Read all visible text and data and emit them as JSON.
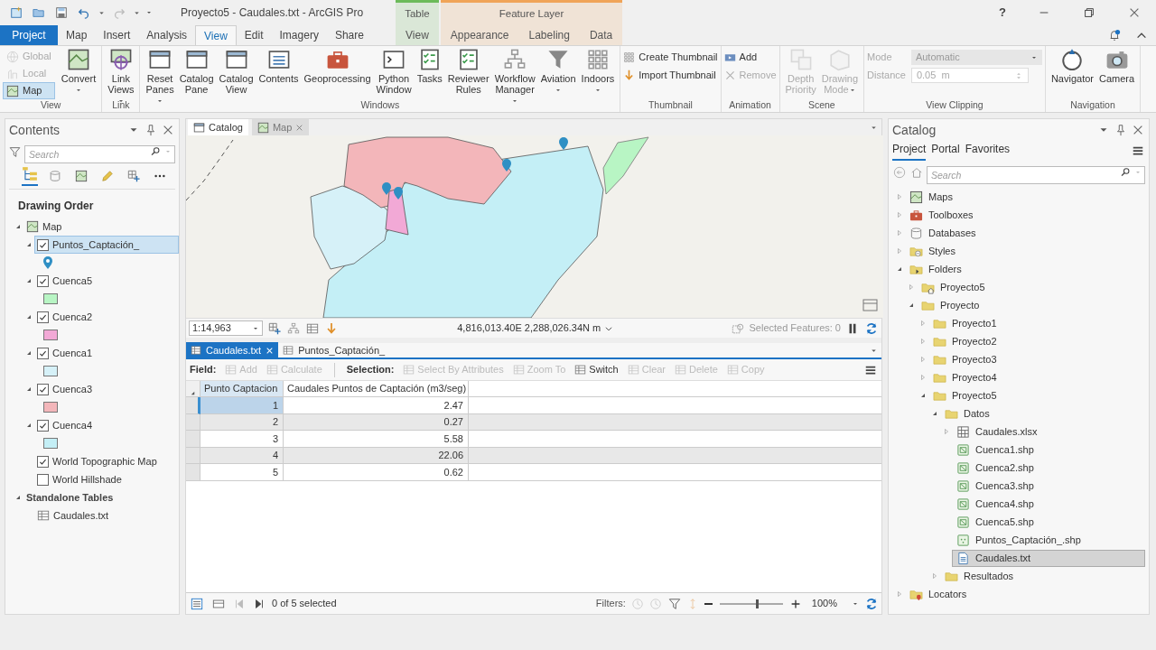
{
  "window": {
    "title": "Proyecto5 - Caudales.txt - ArcGIS Pro",
    "help": "?"
  },
  "ribbon": {
    "tabs": [
      {
        "label": "Project",
        "kind": "project",
        "selected": false
      },
      {
        "label": "Map",
        "kind": "core",
        "selected": false
      },
      {
        "label": "Insert",
        "kind": "core",
        "selected": false
      },
      {
        "label": "Analysis",
        "kind": "core",
        "selected": false
      },
      {
        "label": "View",
        "kind": "core",
        "selected": true
      },
      {
        "label": "Edit",
        "kind": "core",
        "selected": false
      },
      {
        "label": "Imagery",
        "kind": "core",
        "selected": false
      },
      {
        "label": "Share",
        "kind": "core",
        "selected": false
      }
    ],
    "context_groups": [
      {
        "label": "Table",
        "color": "#6cbb5a",
        "tabs": [
          {
            "label": "View",
            "selected": false
          }
        ]
      },
      {
        "label": "Feature Layer",
        "color": "#f0a458",
        "tabs": [
          {
            "label": "Appearance",
            "selected": false
          },
          {
            "label": "Labeling",
            "selected": false
          },
          {
            "label": "Data",
            "selected": false
          }
        ]
      }
    ],
    "groups": [
      {
        "label": "View",
        "modes": [
          {
            "label": "Global",
            "disabled": true,
            "selected": false
          },
          {
            "label": "Local",
            "disabled": true,
            "selected": false
          },
          {
            "label": "Map",
            "disabled": false,
            "selected": true
          }
        ],
        "tools": [
          {
            "label": "Convert",
            "kind": "large",
            "disabled": false,
            "dropdown": true
          }
        ]
      },
      {
        "label": "Link",
        "tools": [
          {
            "label": "Link Views",
            "kind": "large",
            "disabled": false,
            "dropdown": true
          }
        ]
      },
      {
        "label": "Windows",
        "tools": [
          {
            "label": "Reset Panes",
            "kind": "large",
            "disabled": false,
            "dropdown": true
          },
          {
            "label": "Catalog Pane",
            "kind": "large",
            "disabled": false,
            "dropdown": false
          },
          {
            "label": "Catalog View",
            "kind": "large",
            "disabled": false,
            "dropdown": false
          },
          {
            "label": "Contents",
            "kind": "large",
            "disabled": false,
            "dropdown": false
          },
          {
            "label": "Geoprocessing",
            "kind": "large",
            "disabled": false,
            "dropdown": false
          },
          {
            "label": "Python Window",
            "kind": "large",
            "disabled": false,
            "dropdown": false
          },
          {
            "label": "Tasks",
            "kind": "large",
            "disabled": false,
            "dropdown": false
          },
          {
            "label": "Reviewer Rules",
            "kind": "large",
            "disabled": false,
            "dropdown": false
          },
          {
            "label": "Workflow Manager",
            "kind": "large",
            "disabled": false,
            "dropdown": true
          },
          {
            "label": "Aviation",
            "kind": "large",
            "disabled": false,
            "dropdown": true
          },
          {
            "label": "Indoors",
            "kind": "large",
            "disabled": false,
            "dropdown": true
          }
        ]
      },
      {
        "label": "Thumbnail",
        "tools": [
          {
            "label": "Create Thumbnail",
            "kind": "small",
            "disabled": false,
            "dropdown": false
          },
          {
            "label": "Import Thumbnail",
            "kind": "small",
            "disabled": false,
            "dropdown": false
          }
        ]
      },
      {
        "label": "Animation",
        "tools": [
          {
            "label": "Add",
            "kind": "small",
            "disabled": false,
            "dropdown": false
          },
          {
            "label": "Remove",
            "kind": "small",
            "disabled": true,
            "dropdown": false
          }
        ]
      },
      {
        "label": "Scene",
        "tools": [
          {
            "label": "Depth Priority",
            "kind": "large",
            "disabled": true,
            "dropdown": false
          },
          {
            "label": "Drawing Mode",
            "kind": "large",
            "disabled": true,
            "dropdown": true
          }
        ]
      },
      {
        "label": "View Clipping",
        "tools": [
          {
            "label": "Mode",
            "kind": "dropdown",
            "value": "Automatic",
            "disabled": true,
            "dropdown": true
          },
          {
            "label": "Distance",
            "kind": "spinner",
            "value": "0.05  m",
            "disabled": true
          }
        ]
      },
      {
        "label": "Navigation",
        "tools": [
          {
            "label": "Navigator",
            "kind": "large",
            "disabled": false,
            "dropdown": false
          },
          {
            "label": "Camera",
            "kind": "large",
            "disabled": false,
            "dropdown": false
          }
        ]
      }
    ]
  },
  "contents": {
    "title": "Contents",
    "search": {
      "placeholder": "Search"
    },
    "heading": "Drawing Order",
    "tree": [
      {
        "label": "Map",
        "kind": "map",
        "expanded": true,
        "selected": false,
        "children": [
          {
            "label": "Puntos_Captación_",
            "kind": "point_layer",
            "color": "#2f8fc4",
            "checked": true,
            "expanded": true,
            "selected": true
          },
          {
            "label": "Cuenca5",
            "kind": "polygon_layer",
            "color": "#b8f5c4",
            "checked": true,
            "expanded": true,
            "selected": false
          },
          {
            "label": "Cuenca2",
            "kind": "polygon_layer",
            "color": "#f2a9d6",
            "checked": true,
            "expanded": true,
            "selected": false
          },
          {
            "label": "Cuenca1",
            "kind": "polygon_layer",
            "color": "#d6f1f8",
            "checked": true,
            "expanded": true,
            "selected": false
          },
          {
            "label": "Cuenca3",
            "kind": "polygon_layer",
            "color": "#f3b6ba",
            "checked": true,
            "expanded": true,
            "selected": false
          },
          {
            "label": "Cuenca4",
            "kind": "polygon_layer",
            "color": "#c4eff6",
            "checked": true,
            "expanded": true,
            "selected": false
          },
          {
            "label": "World Topographic Map",
            "kind": "basemap",
            "checked": true,
            "selected": false
          },
          {
            "label": "World Hillshade",
            "kind": "basemap",
            "checked": false,
            "selected": false
          }
        ]
      },
      {
        "label": "Standalone Tables",
        "kind": "heading",
        "expanded": true,
        "selected": false,
        "children": [
          {
            "label": "Caudales.txt",
            "kind": "table",
            "selected": false
          }
        ]
      }
    ]
  },
  "views": {
    "tabs": [
      {
        "label": "Catalog",
        "kind": "catalog",
        "selected": false
      },
      {
        "label": "Map",
        "kind": "map",
        "selected": true
      }
    ]
  },
  "map": {
    "scale": "1:14,963",
    "coordinates": "4,816,013.40E 2,288,026.34N m",
    "selected_features": "Selected Features: 0"
  },
  "table_view": {
    "tabs": [
      {
        "label": "Caudales.txt",
        "selected": true
      },
      {
        "label": "Puntos_Captación_",
        "selected": false
      }
    ],
    "toolbar": [
      {
        "kind": "label",
        "label": "Field:"
      },
      {
        "kind": "button",
        "label": "Add",
        "disabled": true
      },
      {
        "kind": "button",
        "label": "Calculate",
        "disabled": true
      },
      {
        "kind": "label",
        "label": "Selection:"
      },
      {
        "kind": "button",
        "label": "Select By Attributes",
        "disabled": true
      },
      {
        "kind": "button",
        "label": "Zoom To",
        "disabled": true
      },
      {
        "kind": "button",
        "label": "Switch",
        "disabled": false
      },
      {
        "kind": "button",
        "label": "Clear",
        "disabled": true
      },
      {
        "kind": "button",
        "label": "Delete",
        "disabled": true
      },
      {
        "kind": "button",
        "label": "Copy",
        "disabled": true
      }
    ],
    "columns": [
      "Punto Captacion",
      "Caudales Puntos de Captación (m3/seg)"
    ],
    "rows": [
      {
        "cells": [
          "1",
          "2.47"
        ],
        "active": true
      },
      {
        "cells": [
          "2",
          "0.27"
        ],
        "active": false
      },
      {
        "cells": [
          "3",
          "5.58"
        ],
        "active": false
      },
      {
        "cells": [
          "4",
          "22.06"
        ],
        "active": false
      },
      {
        "cells": [
          "5",
          "0.62"
        ],
        "active": false
      }
    ],
    "footer": {
      "selection": "0 of 5 selected",
      "filters_label": "Filters:",
      "zoom": {
        "level": 0.6
      },
      "zoom_text": "100%"
    }
  },
  "catalog": {
    "title": "Catalog",
    "tabs": [
      {
        "label": "Project",
        "selected": true
      },
      {
        "label": "Portal",
        "selected": false
      },
      {
        "label": "Favorites",
        "selected": false
      }
    ],
    "search": {
      "placeholder": "Search"
    },
    "tree": [
      {
        "label": "Maps",
        "kind": "maps",
        "expanded": false,
        "selected": false
      },
      {
        "label": "Toolboxes",
        "kind": "toolboxes",
        "expanded": false,
        "selected": false
      },
      {
        "label": "Databases",
        "kind": "databases",
        "expanded": false,
        "selected": false
      },
      {
        "label": "Styles",
        "kind": "styles",
        "expanded": false,
        "selected": false
      },
      {
        "label": "Folders",
        "kind": "folders",
        "expanded": true,
        "selected": false,
        "children": [
          {
            "label": "Proyecto5",
            "kind": "home_folder",
            "expanded": false,
            "selected": false
          },
          {
            "label": "Proyecto",
            "kind": "folder",
            "expanded": true,
            "selected": false,
            "children": [
              {
                "label": "Proyecto1",
                "kind": "folder",
                "expanded": false,
                "selected": false
              },
              {
                "label": "Proyecto2",
                "kind": "folder",
                "expanded": false,
                "selected": false
              },
              {
                "label": "Proyecto3",
                "kind": "folder",
                "expanded": false,
                "selected": false
              },
              {
                "label": "Proyecto4",
                "kind": "folder",
                "expanded": false,
                "selected": false
              },
              {
                "label": "Proyecto5",
                "kind": "folder",
                "expanded": true,
                "selected": false,
                "children": [
                  {
                    "label": "Datos",
                    "kind": "folder",
                    "expanded": true,
                    "selected": false,
                    "children": [
                      {
                        "label": "Caudales.xlsx",
                        "kind": "spreadsheet",
                        "expanded": false,
                        "selected": false
                      },
                      {
                        "label": "Cuenca1.shp",
                        "kind": "shapefile",
                        "selected": false
                      },
                      {
                        "label": "Cuenca2.shp",
                        "kind": "shapefile",
                        "selected": false
                      },
                      {
                        "label": "Cuenca3.shp",
                        "kind": "shapefile",
                        "selected": false
                      },
                      {
                        "label": "Cuenca4.shp",
                        "kind": "shapefile",
                        "selected": false
                      },
                      {
                        "label": "Cuenca5.shp",
                        "kind": "shapefile",
                        "selected": false
                      },
                      {
                        "label": "Puntos_Captación_.shp",
                        "kind": "points",
                        "selected": false
                      },
                      {
                        "label": "Caudales.txt",
                        "kind": "text",
                        "selected": true
                      }
                    ]
                  },
                  {
                    "label": "Resultados",
                    "kind": "folder",
                    "expanded": false,
                    "selected": false
                  }
                ]
              }
            ]
          }
        ]
      },
      {
        "label": "Locators",
        "kind": "locators",
        "expanded": false,
        "selected": false
      }
    ]
  }
}
